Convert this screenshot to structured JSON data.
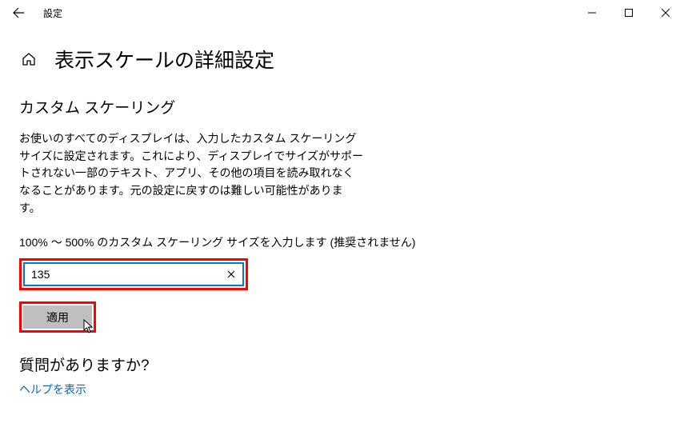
{
  "window": {
    "app_title": "設定"
  },
  "page": {
    "title": "表示スケールの詳細設定"
  },
  "section": {
    "title": "カスタム スケーリング",
    "description": "お使いのすべてのディスプレイは、入力したカスタム スケーリング サイズに設定されます。これにより、ディスプレイでサイズがサポートされない一部のテキスト、アプリ、その他の項目を読み取れなくなることがあります。元の設定に戻すのは難しい可能性があります。",
    "input_label": "100% ～ 500% のカスタム スケーリング サイズを入力します (推奨されません)",
    "input_value": "135",
    "apply_label": "適用"
  },
  "help": {
    "question": "質問がありますか?",
    "link": "ヘルプを表示"
  }
}
